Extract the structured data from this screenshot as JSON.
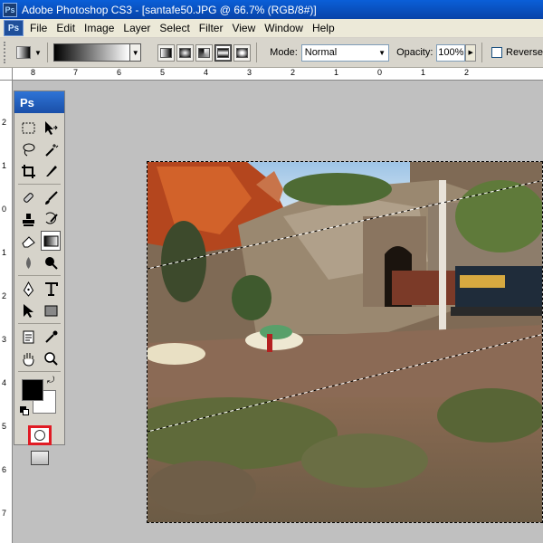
{
  "window": {
    "title": "Adobe Photoshop CS3 - [santafe50.JPG @ 66.7% (RGB/8#)]",
    "app_badge": "Ps"
  },
  "menu": [
    "File",
    "Edit",
    "Image",
    "Layer",
    "Select",
    "Filter",
    "View",
    "Window",
    "Help"
  ],
  "options": {
    "mode_label": "Mode:",
    "mode_value": "Normal",
    "opacity_label": "Opacity:",
    "opacity_value": "100%",
    "reverse_label": "Reverse",
    "gradient_types": [
      "linear-gradient-icon",
      "radial-gradient-icon",
      "angle-gradient-icon",
      "reflected-gradient-icon",
      "diamond-gradient-icon"
    ],
    "active_gradient_type": "reflected-gradient-icon"
  },
  "toolbox": {
    "header": "Ps",
    "tools": [
      [
        "rectangular-marquee-icon",
        "move-icon"
      ],
      [
        "lasso-icon",
        "magic-wand-icon"
      ],
      [
        "crop-icon",
        "slice-icon"
      ],
      [
        "healing-brush-icon",
        "brush-icon"
      ],
      [
        "clone-stamp-icon",
        "history-brush-icon"
      ],
      [
        "eraser-icon",
        "gradient-icon"
      ],
      [
        "blur-icon",
        "dodge-icon"
      ],
      [
        "pen-icon",
        "type-icon"
      ],
      [
        "path-selection-icon",
        "rectangle-shape-icon"
      ],
      [
        "notes-icon",
        "eyedropper-icon"
      ],
      [
        "hand-icon",
        "zoom-icon"
      ]
    ],
    "active_tool": "gradient-icon",
    "foreground_color": "#000000",
    "background_color": "#ffffff",
    "quick_mask_highlight": "#e01b24"
  },
  "rulers": {
    "top": [
      "8",
      "7",
      "6",
      "5",
      "4",
      "3",
      "2",
      "1",
      "0",
      "1",
      "2"
    ],
    "left": [
      "2",
      "1",
      "0",
      "1",
      "2",
      "3",
      "4",
      "5",
      "6",
      "7"
    ]
  },
  "document": {
    "filename": "santafe50.JPG",
    "zoom": "66.7%"
  }
}
